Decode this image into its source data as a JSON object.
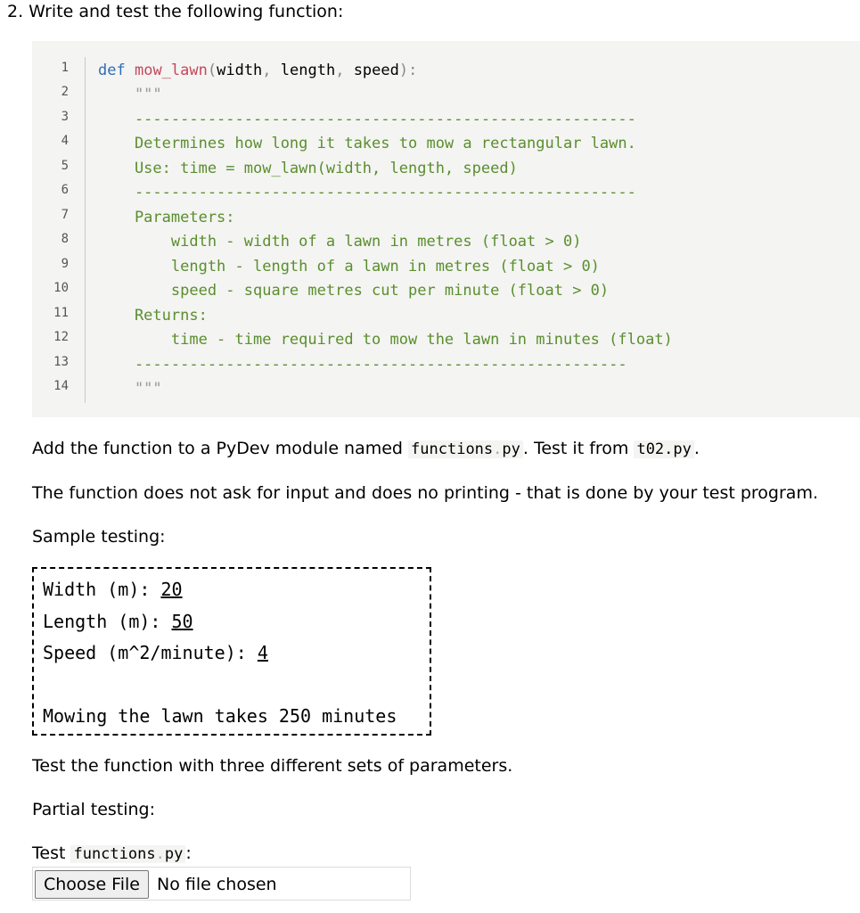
{
  "heading": "2. Write and test the following function:",
  "code": {
    "line_numbers": [
      "1",
      "2",
      "3",
      "4",
      "5",
      "6",
      "7",
      "8",
      "9",
      "10",
      "11",
      "12",
      "13",
      "14"
    ],
    "def_keyword": "def",
    "func_name": "mow_lawn",
    "open_paren": "(",
    "param_width": "width",
    "comma1": ", ",
    "param_length": "length",
    "comma2": ", ",
    "param_speed": "speed",
    "close": "):",
    "line2": "    \"\"\"",
    "line3": "    -------------------------------------------------------",
    "line4": "    Determines how long it takes to mow a rectangular lawn.",
    "line5": "    Use: time = mow_lawn(width, length, speed)",
    "line6": "    -------------------------------------------------------",
    "line7": "    Parameters:",
    "line8": "        width - width of a lawn in metres (float > 0)",
    "line9": "        length - length of a lawn in metres (float > 0)",
    "line10": "        speed - square metres cut per minute (float > 0)",
    "line11": "    Returns:",
    "line12": "        time - time required to mow the lawn in minutes (float)",
    "line13": "    ------------------------------------------------------",
    "line14": "    \"\"\""
  },
  "para1": {
    "prefix": "Add the function to a PyDev module named ",
    "code1_name": "functions",
    "code1_dot": ".",
    "code1_ext": "py",
    "middle": ". Test it from ",
    "code2": "t02.py",
    "suffix": "."
  },
  "para2": "The function does not ask for input and does no printing - that is done by your test program.",
  "para3": "Sample testing:",
  "sample": {
    "width_prompt": "Width (m): ",
    "width_value": "20",
    "length_prompt": "Length (m): ",
    "length_value": "50",
    "speed_prompt": "Speed (m^2/minute): ",
    "speed_value": "4",
    "result": "Mowing the lawn takes 250 minutes"
  },
  "para4": "Test the function with three different sets of parameters.",
  "para5": "Partial testing:",
  "upload": {
    "label_prefix": "Test ",
    "code_name": "functions",
    "code_dot": ".",
    "code_ext": "py",
    "label_suffix": ":",
    "button_label": "Choose File",
    "status": "No file chosen"
  }
}
